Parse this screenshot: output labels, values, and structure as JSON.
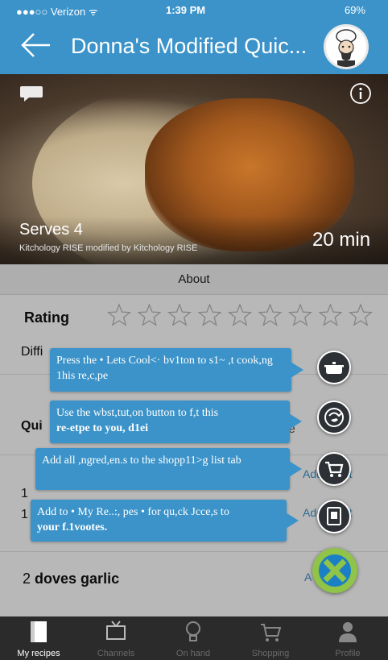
{
  "status_bar": {
    "carrier": "●●●○○ Verizon ᯤ",
    "time": "1:39 PM",
    "right": "69%"
  },
  "header": {
    "title": "Donna's Modified Quic...",
    "color": "#3b93c9"
  },
  "hero": {
    "serves": "Serves 4",
    "byline": "Kitchology RISE modified by Kitchology RISE",
    "time": "20 min"
  },
  "about": {
    "label": "About"
  },
  "rating": {
    "label": "Rating",
    "stars_total": 9,
    "stars_filled": 0
  },
  "difficulty": {
    "label": "Diffi"
  },
  "quick": {
    "label": "Qui",
    "suffix": "e"
  },
  "ingredients": [
    {
      "text": "1",
      "add": "Add to list"
    },
    {
      "text": "1",
      "add": "Add to list"
    },
    {
      "amount": "2",
      "name": "doves garlic",
      "add": "A"
    }
  ],
  "tooltips": [
    {
      "text": "Press the • Lets Cool<· bv1ton to s1~ ,t cook,ng 1his re,c,pe"
    },
    {
      "line1": "Use the wbst,tut,on button to f,t this",
      "line2": "re-etpe to you, d1ei"
    },
    {
      "text": "Add all ,ngred,en.s to the shopp11>g list tab"
    },
    {
      "line1": "Add to • My Re..:, pes • for qu,ck Jcce,s to",
      "line2": "your f.1vootes."
    }
  ],
  "tabs": [
    {
      "label": "My recipes",
      "icon": "book-icon"
    },
    {
      "label": "Channels",
      "icon": "tv-icon"
    },
    {
      "label": "On hand",
      "icon": "lightbulb-icon"
    },
    {
      "label": "Shopping",
      "icon": "cart-icon"
    },
    {
      "label": "Profile",
      "icon": "person-icon"
    }
  ]
}
